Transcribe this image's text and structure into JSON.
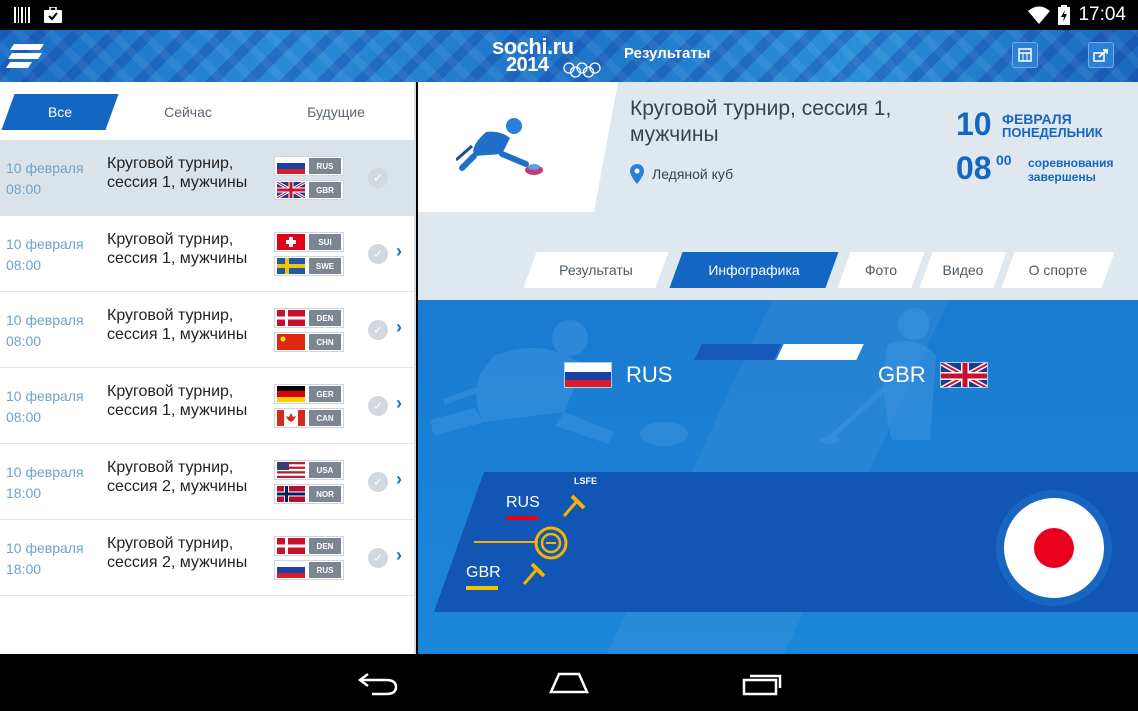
{
  "status_bar": {
    "time": "17:04"
  },
  "app": {
    "logo_line1": "sochi.ru",
    "logo_line2": "2014",
    "title": "Результаты"
  },
  "filters": [
    "Все",
    "Сейчас",
    "Будущие"
  ],
  "events": [
    {
      "date": "10 февраля",
      "time": "08:00",
      "name": "Круговой турнир, сессия 1, мужчины",
      "team1": "RUS",
      "team2": "GBR"
    },
    {
      "date": "10 февраля",
      "time": "08:00",
      "name": "Круговой турнир, сессия 1, мужчины",
      "team1": "SUI",
      "team2": "SWE"
    },
    {
      "date": "10 февраля",
      "time": "08:00",
      "name": "Круговой турнир, сессия 1, мужчины",
      "team1": "DEN",
      "team2": "CHN"
    },
    {
      "date": "10 февраля",
      "time": "08:00",
      "name": "Круговой турнир, сессия 1, мужчины",
      "team1": "GER",
      "team2": "CAN"
    },
    {
      "date": "10 февраля",
      "time": "18:00",
      "name": "Круговой турнир, сессия 2, мужчины",
      "team1": "USA",
      "team2": "NOR"
    },
    {
      "date": "10 февраля",
      "time": "18:00",
      "name": "Круговой турнир, сессия 2, мужчины",
      "team1": "DEN",
      "team2": "RUS"
    }
  ],
  "detail": {
    "title": "Круговой турнир, сессия 1, мужчины",
    "venue": "Ледяной куб",
    "day": "10",
    "month": "ФЕВРАЛЯ",
    "weekday": "ПОНЕДЕЛЬНИК",
    "hour": "08",
    "minutes": "00",
    "status": "соревнования завершены",
    "tabs": [
      "Результаты",
      "Инфографика",
      "Фото",
      "Видео",
      "О спорте"
    ]
  },
  "infographic": {
    "team_left": "RUS",
    "team_right": "GBR",
    "lsfe_label": "LSFE",
    "rink_team1": "RUS",
    "rink_team2": "GBR"
  },
  "colors": {
    "accent": "#1366c2",
    "rus_bar": "#e8001c",
    "gbr_bar": "#f5c400"
  }
}
